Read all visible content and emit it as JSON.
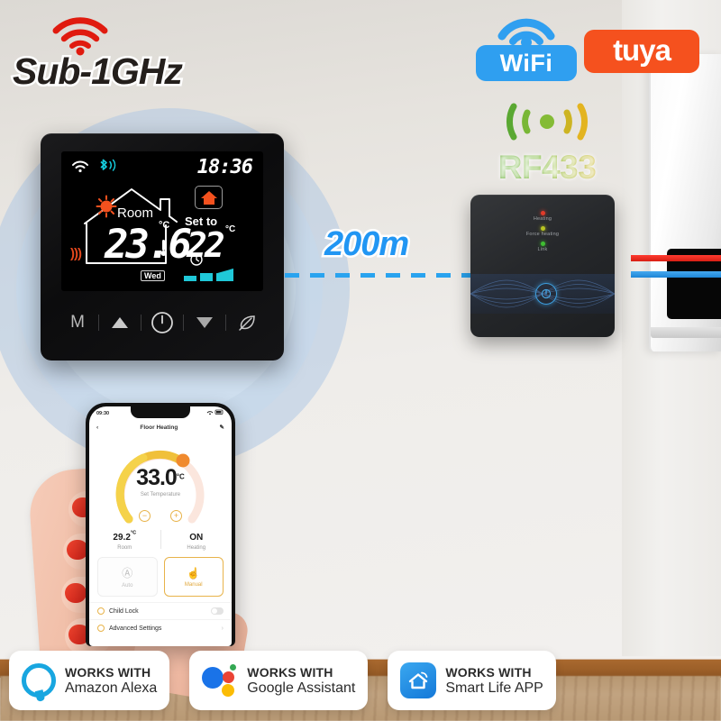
{
  "badges_top": {
    "sub1ghz": {
      "label": "Sub-1GHz",
      "icon": "wifi-signal-icon",
      "color": "#d92b1f"
    },
    "wifi": {
      "label": "WiFi",
      "icon": "wifi-icon",
      "color": "#2f9ff0"
    },
    "tuya": {
      "label": "tuya",
      "color": "#f5511e"
    },
    "rf433": {
      "label": "RF433",
      "icon": "rf-signal-icon",
      "color_start": "#5aa832",
      "color_end": "#e3b420"
    }
  },
  "link": {
    "distance_label": "200m",
    "line_color": "#29a3ef"
  },
  "thermostat": {
    "display": {
      "wifi_icon": "wifi-icon",
      "bluetooth_icon": "bluetooth-icon",
      "clock": "18:36",
      "sun_icon": "sun-icon",
      "heating_icon": "heat-waves-icon",
      "room_label": "Room",
      "room_temp": "23.6",
      "room_unit": "°C",
      "mode_icon": "home-icon",
      "set_label": "Set to",
      "set_temp": "22",
      "set_unit": "°C",
      "timer_icon": "clock-icon",
      "fan_icon": "fan-speed-bars",
      "day": "Wed"
    },
    "buttons": [
      {
        "name": "mode-button",
        "label": "M"
      },
      {
        "name": "up-button",
        "label": "▲"
      },
      {
        "name": "power-button",
        "label": "⏻"
      },
      {
        "name": "down-button",
        "label": "▼"
      },
      {
        "name": "eco-leaf-button",
        "label": "leaf"
      }
    ]
  },
  "receiver": {
    "leds": [
      {
        "label": "Heating",
        "color": "#e13b2a"
      },
      {
        "label": "Force heating",
        "color": "#b8c422"
      },
      {
        "label": "Link",
        "color": "#3fbe32"
      }
    ],
    "power_icon": "power-icon"
  },
  "phone": {
    "status_bar": {
      "time": "09:30",
      "location_icon": "location-arrow-icon",
      "wifi_icon": "wifi-icon",
      "battery_icon": "battery-icon"
    },
    "header": {
      "back_icon": "back-chevron-icon",
      "title": "Floor Heating",
      "edit_icon": "pencil-icon"
    },
    "dial": {
      "temperature": "33.0",
      "unit": "°C",
      "caption": "Set Temperature",
      "minus_label": "−",
      "plus_label": "+"
    },
    "readouts": [
      {
        "value": "29.2",
        "unit": "°C",
        "label": "Room"
      },
      {
        "value": "ON",
        "unit": "",
        "label": "Heating"
      }
    ],
    "modes": [
      {
        "label": "Auto",
        "icon": "auto-circle-icon",
        "active": false
      },
      {
        "label": "Manual",
        "icon": "hand-tap-icon",
        "active": true
      }
    ],
    "settings": [
      {
        "label": "Child Lock",
        "control": "toggle",
        "enabled": false
      },
      {
        "label": "Advanced Settings",
        "control": "chevron"
      }
    ]
  },
  "partner_badges": [
    {
      "top": "WORKS WITH",
      "bottom": "Amazon Alexa",
      "icon": "amazon-alexa-icon"
    },
    {
      "top": "WORKS WITH",
      "bottom": "Google Assistant",
      "icon": "google-assistant-icon"
    },
    {
      "top": "WORKS WITH",
      "bottom": "Smart Life APP",
      "icon": "smart-life-icon"
    }
  ]
}
